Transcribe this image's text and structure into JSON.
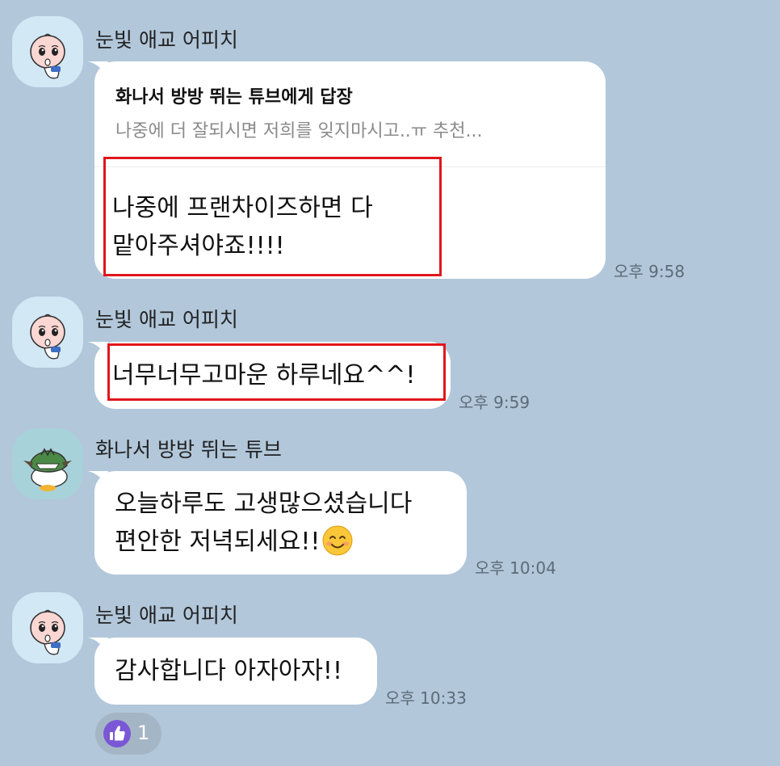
{
  "colors": {
    "background": "#b2c7da",
    "bubble": "#ffffff",
    "highlight_box": "#e0171c",
    "timestamp": "#5c6b78",
    "reaction_button": "#7a57d4"
  },
  "messages": [
    {
      "sender": "눈빛 애교 어피치",
      "avatar_icon": "apeach-character-icon",
      "reply": {
        "title": "화나서 방방 뛰는 튜브에게 답장",
        "preview": "나중에 더 잘되시면 저희를 잊지마시고..ㅠ 추천..."
      },
      "lines": [
        "나중에 프랜차이즈하면 다",
        "맡아주셔야죠!!!!"
      ],
      "time": "오후 9:58"
    },
    {
      "sender": "눈빛 애교 어피치",
      "avatar_icon": "apeach-character-icon",
      "lines": [
        "너무너무고마운 하루네요^^!"
      ],
      "time": "오후 9:59"
    },
    {
      "sender": "화나서 방방 뛰는 튜브",
      "avatar_icon": "tube-character-icon",
      "lines": [
        "오늘하루도 고생많으셨습니다",
        "편안한 저녁되세요!!"
      ],
      "emoji_icon": "smiling-face-emoji-icon",
      "time": "오후 10:04"
    },
    {
      "sender": "눈빛 애교 어피치",
      "avatar_icon": "apeach-character-icon",
      "lines": [
        "감사합니다 아자아자!!"
      ],
      "time": "오후 10:33",
      "reaction": {
        "icon": "thumbs-up-icon",
        "count": "1"
      }
    }
  ]
}
